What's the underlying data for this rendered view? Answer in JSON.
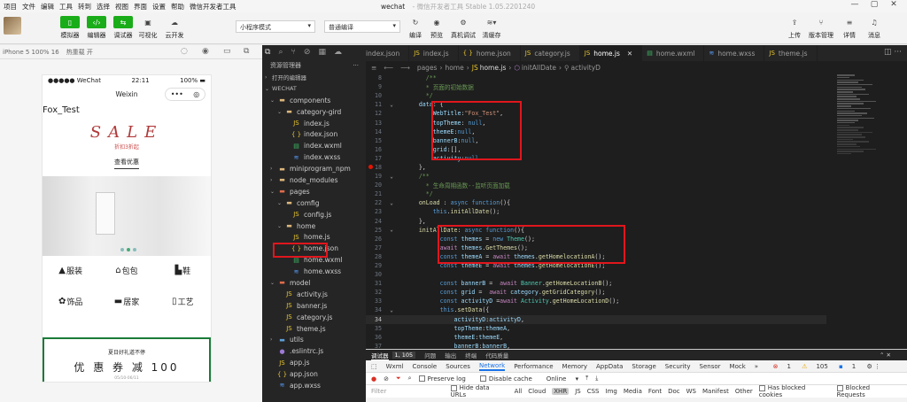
{
  "menubar": {
    "items": [
      "项目",
      "文件",
      "编辑",
      "工具",
      "转到",
      "选择",
      "视图",
      "界面",
      "设置",
      "帮助",
      "微信开发者工具"
    ],
    "window_title": "wechat",
    "window_subtitle": "- 微信开发者工具 Stable 1.05.2201240"
  },
  "toolbar": {
    "left_buttons": [
      "模拟器",
      "编辑器",
      "调试器",
      "可视化",
      "云开发"
    ],
    "mode_select": "小程序模式",
    "compile_select": "普通编译",
    "center_buttons": [
      "编译",
      "预览",
      "真机调试",
      "清缓存"
    ],
    "right_buttons": [
      "上传",
      "版本管理",
      "详情",
      "消息"
    ]
  },
  "simulator": {
    "device": "iPhone 5 100% 16",
    "hot_reload": "热重载 开",
    "status_carrier": "●●●●● WeChat",
    "status_time": "22:11",
    "status_battery": "100%",
    "nav_title": "Weixin",
    "site_title": "Fox_Test",
    "sale_title": "SALE",
    "sale_sub": "折扣3折起",
    "sale_link": "查看优惠",
    "categories": [
      {
        "icon": "skirt",
        "label": "服装"
      },
      {
        "icon": "bag",
        "label": "包包"
      },
      {
        "icon": "shoe",
        "label": "鞋"
      },
      {
        "icon": "accessory",
        "label": "饰品"
      },
      {
        "icon": "home",
        "label": "居家"
      },
      {
        "icon": "craft",
        "label": "工艺"
      }
    ],
    "coupon_title": "夏日好礼道不停",
    "coupon_main": "优 惠 券 减 100",
    "coupon_date": "05/10-06/11"
  },
  "explorer": {
    "header": "资源管理器",
    "sections": [
      "打开的编辑器",
      "WECHAT"
    ],
    "tree": [
      {
        "label": "components",
        "depth": 1,
        "kind": "folder",
        "open": true
      },
      {
        "label": "category-gird",
        "depth": 2,
        "kind": "folder",
        "open": true
      },
      {
        "label": "index.js",
        "depth": 3,
        "kind": "js"
      },
      {
        "label": "index.json",
        "depth": 3,
        "kind": "json"
      },
      {
        "label": "index.wxml",
        "depth": 3,
        "kind": "wxml"
      },
      {
        "label": "index.wxss",
        "depth": 3,
        "kind": "wxss"
      },
      {
        "label": "miniprogram_npm",
        "depth": 1,
        "kind": "folder",
        "open": false
      },
      {
        "label": "node_modules",
        "depth": 1,
        "kind": "folder",
        "open": false
      },
      {
        "label": "pages",
        "depth": 1,
        "kind": "folder-red",
        "open": true
      },
      {
        "label": "comfig",
        "depth": 2,
        "kind": "folder",
        "open": true
      },
      {
        "label": "config.js",
        "depth": 3,
        "kind": "js"
      },
      {
        "label": "home",
        "depth": 2,
        "kind": "folder",
        "open": true
      },
      {
        "label": "home.js",
        "depth": 3,
        "kind": "js",
        "selected": true
      },
      {
        "label": "home.json",
        "depth": 3,
        "kind": "json"
      },
      {
        "label": "home.wxml",
        "depth": 3,
        "kind": "wxml"
      },
      {
        "label": "home.wxss",
        "depth": 3,
        "kind": "wxss"
      },
      {
        "label": "model",
        "depth": 1,
        "kind": "folder-red",
        "open": true
      },
      {
        "label": "activity.js",
        "depth": 2,
        "kind": "js"
      },
      {
        "label": "banner.js",
        "depth": 2,
        "kind": "js"
      },
      {
        "label": "category.js",
        "depth": 2,
        "kind": "js"
      },
      {
        "label": "theme.js",
        "depth": 2,
        "kind": "js"
      },
      {
        "label": "utils",
        "depth": 1,
        "kind": "folder-blue",
        "open": false
      },
      {
        "label": ".eslintrc.js",
        "depth": 1,
        "kind": "lint"
      },
      {
        "label": "app.js",
        "depth": 1,
        "kind": "js"
      },
      {
        "label": "app.json",
        "depth": 1,
        "kind": "json"
      },
      {
        "label": "app.wxss",
        "depth": 1,
        "kind": "wxss"
      }
    ]
  },
  "editor": {
    "tabs": [
      {
        "label": "index.json",
        "kind": "json"
      },
      {
        "label": "index.js",
        "kind": "js"
      },
      {
        "label": "home.json",
        "kind": "json"
      },
      {
        "label": "category.js",
        "kind": "js"
      },
      {
        "label": "home.js",
        "kind": "js",
        "active": true
      },
      {
        "label": "home.wxml",
        "kind": "wxml"
      },
      {
        "label": "home.wxss",
        "kind": "wxss"
      },
      {
        "label": "theme.js",
        "kind": "js"
      }
    ],
    "breadcrumb": [
      "pages",
      "home",
      "home.js",
      "initAllDate",
      "activityD"
    ],
    "current_line": 34
  },
  "devtools": {
    "bar1": [
      "调试器",
      "1, 105",
      "问题",
      "输出",
      "终端",
      "代码质量"
    ],
    "tabs": [
      "Wxml",
      "Console",
      "Sources",
      "Network",
      "Performance",
      "Memory",
      "AppData",
      "Storage",
      "Security",
      "Sensor",
      "Mock",
      "»"
    ],
    "active_tab": "Network",
    "error_count": "1",
    "warn_count": "105",
    "info_count": "1",
    "row3": [
      "Preserve log",
      "Disable cache",
      "Online"
    ],
    "filter_placeholder": "Filter",
    "row4": [
      "Hide data URLs",
      "All",
      "Cloud",
      "XHR",
      "JS",
      "CSS",
      "Img",
      "Media",
      "Font",
      "Doc",
      "WS",
      "Manifest",
      "Other",
      "Has blocked cookies",
      "Blocked Requests"
    ]
  }
}
